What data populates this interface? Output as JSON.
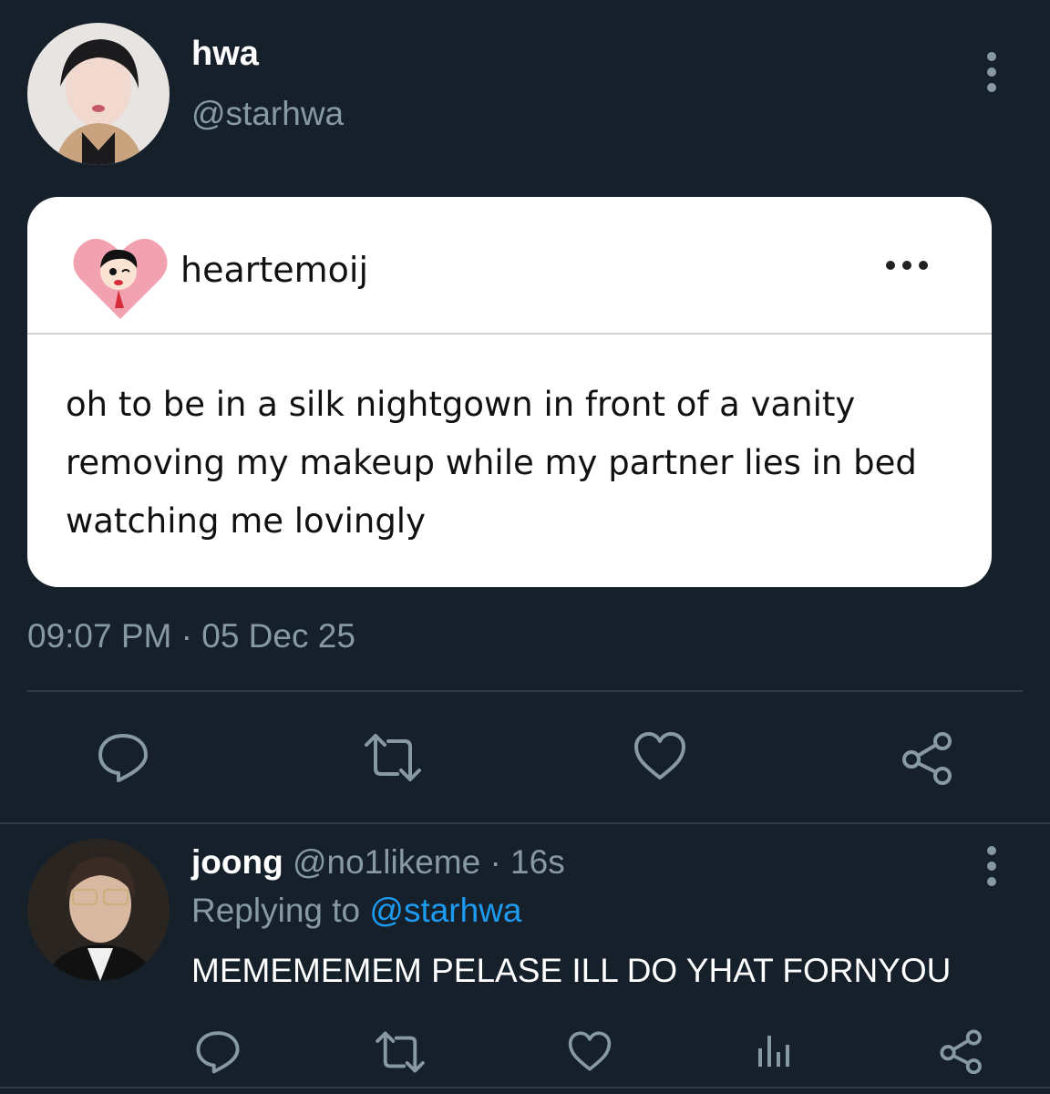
{
  "tweet": {
    "display_name": "hwa",
    "handle": "@starhwa",
    "menu_icon": "more-vertical-icon",
    "avatar_icon": "user-avatar",
    "embedded": {
      "username": "heartemoij",
      "avatar_icon": "heart-cartoon-avatar",
      "menu_icon": "more-horizontal-icon",
      "text": "oh to be in a silk nightgown in front of a vanity removing my makeup while my partner lies in bed watching me lovingly"
    },
    "timestamp": "09:07 PM · 05 Dec 25",
    "actions": [
      "reply-icon",
      "retweet-icon",
      "like-icon",
      "share-icon"
    ]
  },
  "reply": {
    "display_name": "joong",
    "meta": "@no1likeme · 16s",
    "replying_prefix": "Replying to",
    "replying_to": "@starhwa",
    "text": "MEMEMEMEM PELASE ILL DO YHAT FORNYOU",
    "actions": [
      "reply-icon",
      "retweet-icon",
      "like-icon",
      "analytics-icon",
      "share-icon"
    ]
  },
  "colors": {
    "background": "#15202b",
    "secondary_text": "#8899a6",
    "accent": "#1d9bf0",
    "divider": "#2f3b47"
  }
}
